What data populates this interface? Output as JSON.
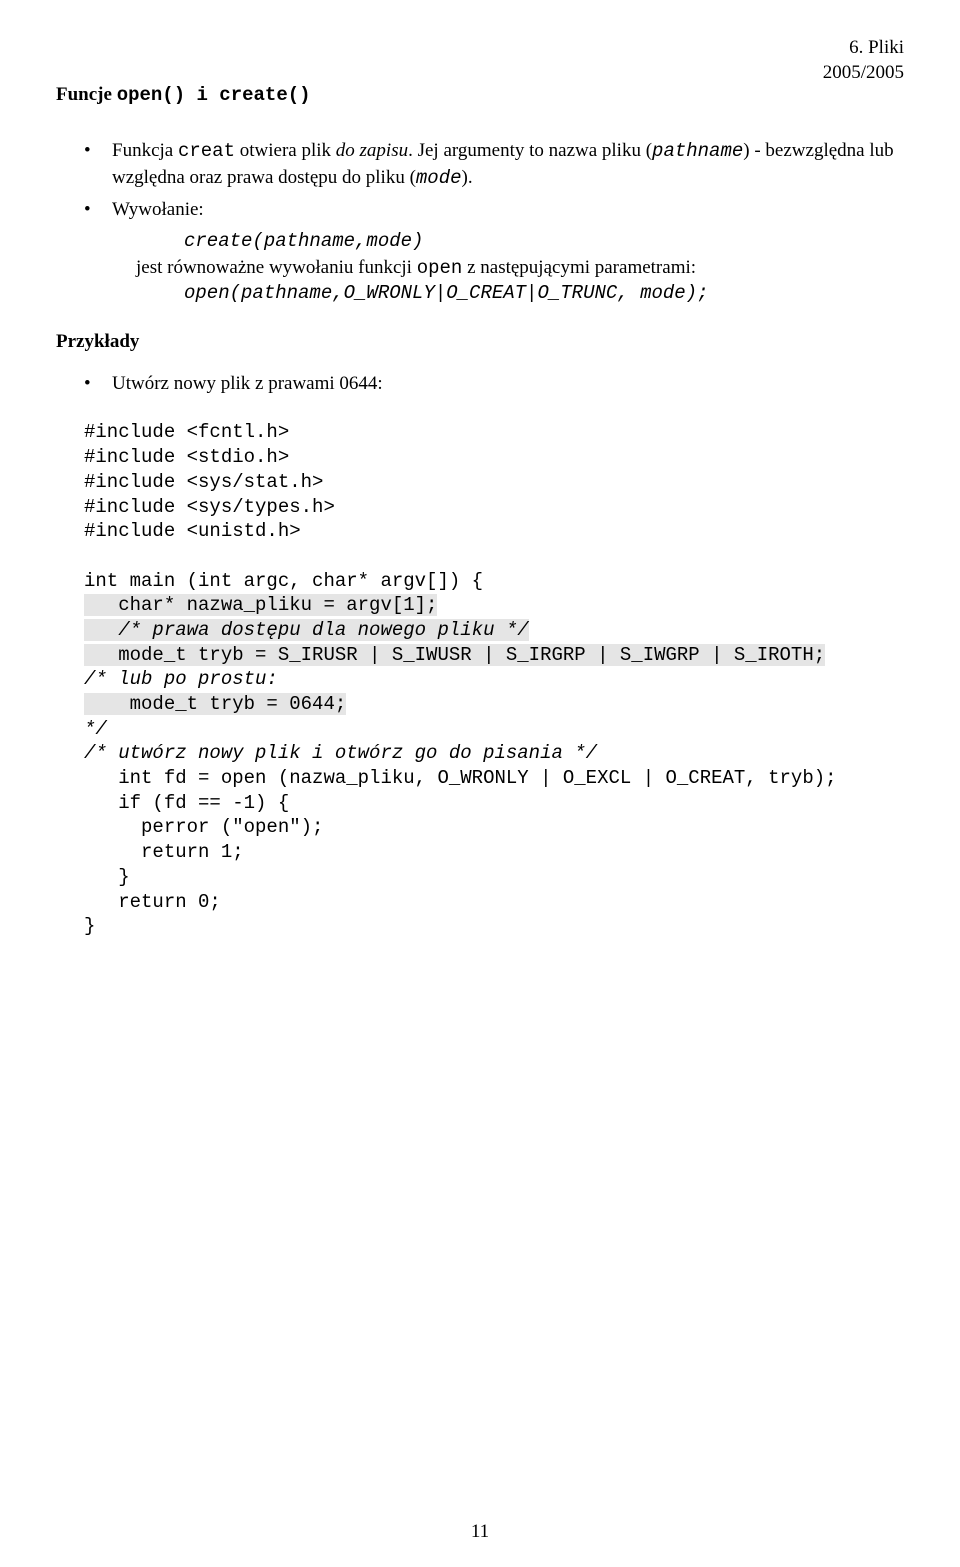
{
  "header": {
    "chapter": "6. Pliki",
    "year": "2005/2005"
  },
  "title_parts": {
    "prefix": "Funcje ",
    "code": "open() i create()"
  },
  "bullets": {
    "b1": {
      "t1": "Funkcja ",
      "c1": "creat",
      "t2": " otwiera plik ",
      "i1": "do zapisu",
      "t3": ". Jej argumenty to nazwa pliku (",
      "c2_i": "pathname",
      "t4": ") - bezwzględna lub względna oraz prawa dostępu do pliku (",
      "c3_i": "mode",
      "t5": ")."
    },
    "b2": {
      "t1": "Wywołanie:",
      "call1": "create(pathname,mode)",
      "jest1": "jest równoważne wywołaniu funkcji ",
      "open_word": "open",
      "jest2": " z następującymi parametrami:",
      "call2": "open(pathname,O_WRONLY|O_CREAT|O_TRUNC, mode);"
    }
  },
  "examples_heading": "Przykłady",
  "example_bullet": "Utwórz nowy plik z prawami 0644:",
  "code": {
    "inc1": "#include <fcntl.h>",
    "inc2": "#include <stdio.h>",
    "inc3": "#include <sys/stat.h>",
    "inc4": "#include <sys/types.h>",
    "inc5": "#include <unistd.h>",
    "l1": "int main (int argc, char* argv[]) {",
    "l2": "   char* nazwa_pliku = argv[1];",
    "l3": "   /* prawa dostępu dla nowego pliku */",
    "l4": "   mode_t tryb = S_IRUSR | S_IWUSR | S_IRGRP | S_IWGRP | S_IROTH;",
    "l5": "/* lub po prostu:",
    "l6": "    mode_t tryb = 0644;",
    "l7": "*/",
    "l8": "/* utwórz nowy plik i otwórz go do pisania */",
    "l9": "   int fd = open (nazwa_pliku, O_WRONLY | O_EXCL | O_CREAT, tryb);",
    "l10": "   if (fd == -1) {",
    "l11": "     perror (\"open\");",
    "l12": "     return 1;",
    "l13": "   }",
    "l14": "   return 0;",
    "l15": "}"
  },
  "page_number": "11"
}
